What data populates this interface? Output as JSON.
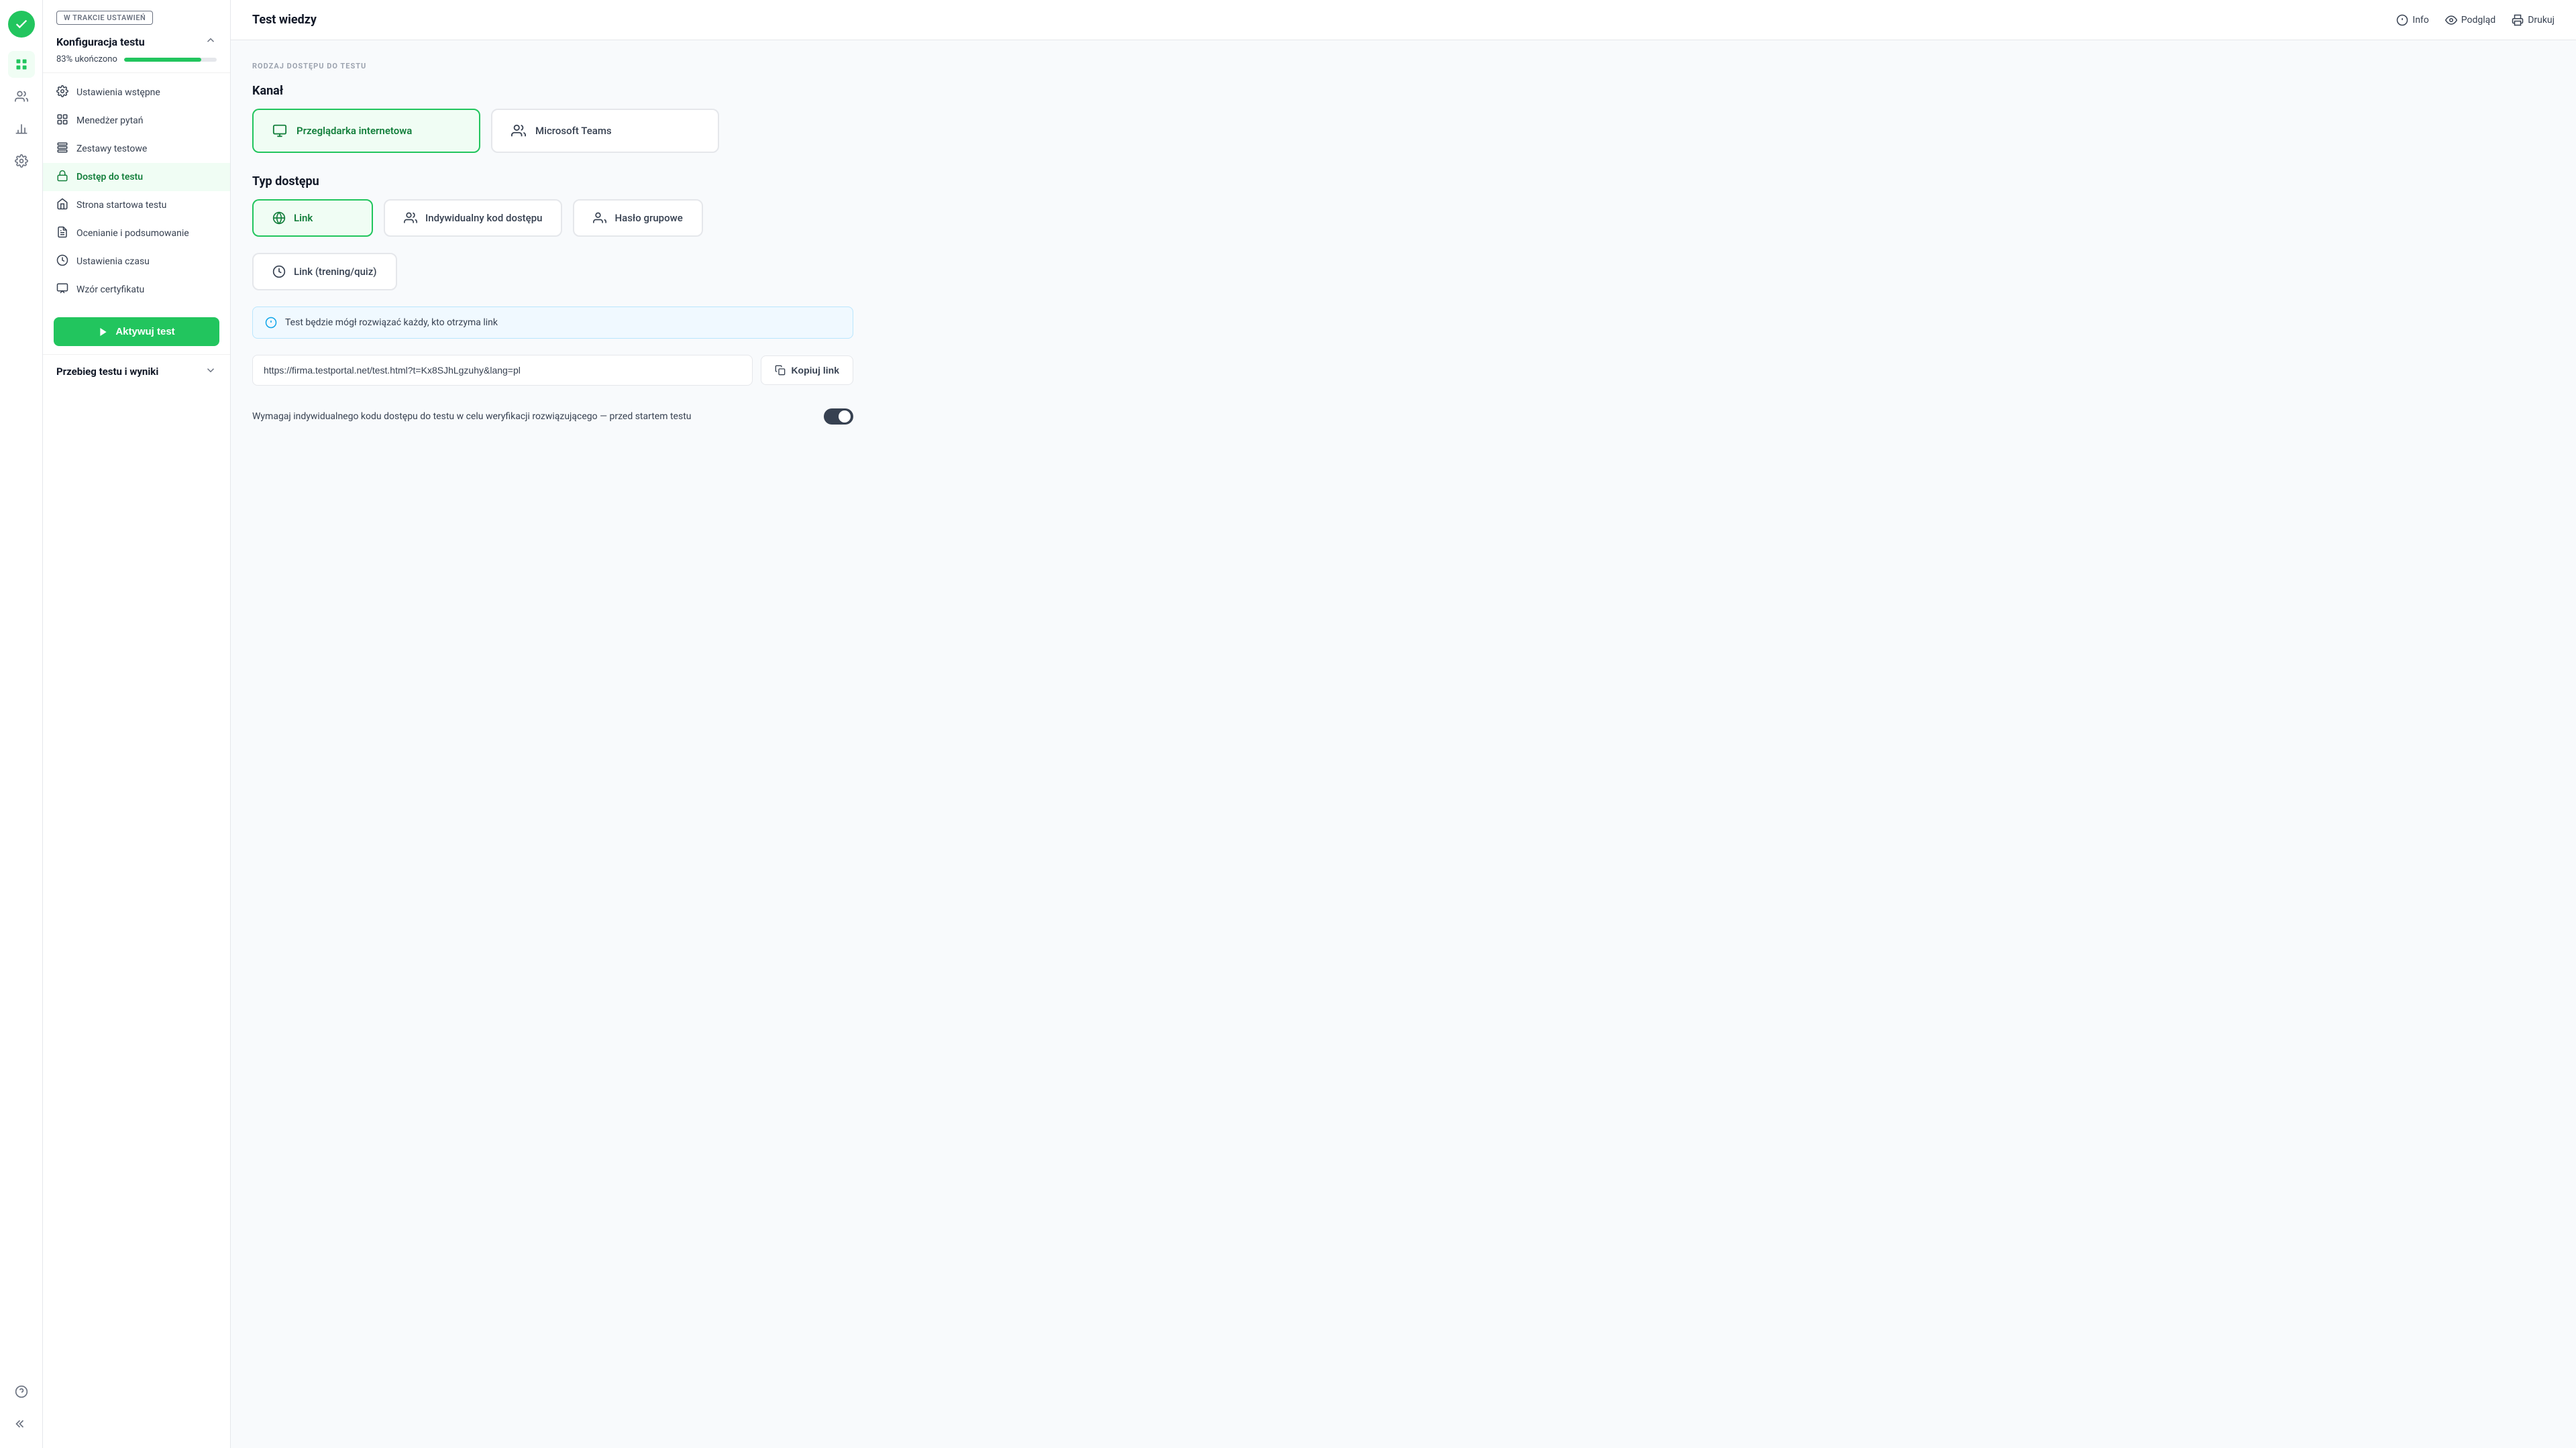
{
  "app": {
    "title": "Test wiedzy"
  },
  "topbar": {
    "title": "Test wiedzy",
    "actions": {
      "info_label": "Info",
      "preview_label": "Podgląd",
      "print_label": "Drukuj"
    }
  },
  "sidebar": {
    "status_badge": "W TRAKCIE USTAWIEŃ",
    "config_section_title": "Konfiguracja testu",
    "progress_label": "83% ukończono",
    "progress_value": 83,
    "nav_items": [
      {
        "id": "ustawienia",
        "label": "Ustawienia wstępne",
        "icon": "settings"
      },
      {
        "id": "menedzer",
        "label": "Menedżer pytań",
        "icon": "questions"
      },
      {
        "id": "zestawy",
        "label": "Zestawy testowe",
        "icon": "sets"
      },
      {
        "id": "dostep",
        "label": "Dostęp do testu",
        "icon": "lock",
        "active": true
      },
      {
        "id": "strona",
        "label": "Strona startowa testu",
        "icon": "home"
      },
      {
        "id": "ocenianie",
        "label": "Ocenianie i podsumowanie",
        "icon": "grade"
      },
      {
        "id": "czas",
        "label": "Ustawienia czasu",
        "icon": "clock"
      },
      {
        "id": "certyfikat",
        "label": "Wzór certyfikatu",
        "icon": "certificate"
      }
    ],
    "activate_button": "Aktywuj test",
    "results_section_title": "Przebieg testu i wyniki"
  },
  "main": {
    "page_title": "Dostęp do testu",
    "section_label": "RODZAJ DOSTĘPU DO TESTU",
    "channel_title": "Kanał",
    "channels": [
      {
        "id": "browser",
        "label": "Przeglądarka internetowa",
        "selected": true
      },
      {
        "id": "teams",
        "label": "Microsoft Teams",
        "selected": false
      }
    ],
    "access_type_title": "Typ dostępu",
    "access_types_row1": [
      {
        "id": "link",
        "label": "Link",
        "selected": true
      },
      {
        "id": "individual_code",
        "label": "Indywidualny kod dostępu",
        "selected": false
      },
      {
        "id": "group_password",
        "label": "Hasło grupowe",
        "selected": false
      }
    ],
    "access_types_row2": [
      {
        "id": "link_training",
        "label": "Link (trening/quiz)",
        "selected": false
      }
    ],
    "info_message": "Test będzie mógł rozwiązać każdy, kto otrzyma link",
    "link_url": "https://firma.testportal.net/test.html?t=Kx8SJhLgzuhy&lang=pl",
    "copy_button_label": "Kopiuj link",
    "toggle_label": "Wymagaj indywidualnego kodu dostępu do testu w celu weryfikacji rozwiązującego — przed startem testu"
  }
}
